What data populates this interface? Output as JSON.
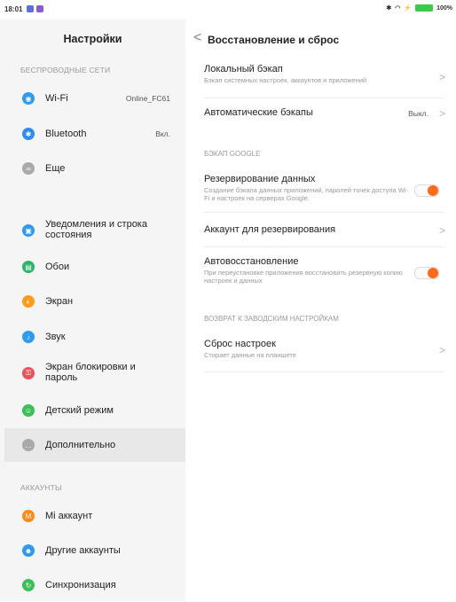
{
  "status": {
    "time": "18:01",
    "battery": "100%"
  },
  "left": {
    "title": "Настройки",
    "section_wireless": "БЕСПРОВОДНЫЕ СЕТИ",
    "wifi": {
      "label": "Wi-Fi",
      "value": "Online_FC61"
    },
    "bluetooth": {
      "label": "Bluetooth",
      "value": "Вкл."
    },
    "more": {
      "label": "Еще"
    },
    "notifications": {
      "label": "Уведомления и строка состояния"
    },
    "wallpaper": {
      "label": "Обои"
    },
    "display": {
      "label": "Экран"
    },
    "sound": {
      "label": "Звук"
    },
    "lockscreen": {
      "label": "Экран блокировки и пароль"
    },
    "kids": {
      "label": "Детский режим"
    },
    "additional": {
      "label": "Дополнительно"
    },
    "section_accounts": "АККАУНТЫ",
    "mi_account": {
      "label": "Mi аккаунт"
    },
    "other_accounts": {
      "label": "Другие аккаунты"
    },
    "sync": {
      "label": "Синхронизация"
    }
  },
  "right": {
    "title": "Восстановление и сброс",
    "local_backup": {
      "title": "Локальный бэкап",
      "subtitle": "Бэкап системных настроек, аккаунтов и приложений"
    },
    "auto_backup": {
      "title": "Автоматические бэкапы",
      "value": "Выкл."
    },
    "section_google": "БЭКАП GOOGLE",
    "data_backup": {
      "title": "Резервирование данных",
      "subtitle": "Создание бэкапа данных приложений, паролей точек доступа Wi-Fi и настроек на серверах Google.",
      "enabled": true
    },
    "backup_account": {
      "title": "Аккаунт для резервирования"
    },
    "auto_restore": {
      "title": "Автовосстановление",
      "subtitle": "При переустановке приложения восстановить резервную копию настроек и данных",
      "enabled": true
    },
    "section_factory": "ВОЗВРАТ К ЗАВОДСКИМ НАСТРОЙКАМ",
    "factory_reset": {
      "title": "Сброс настроек",
      "subtitle": "Стирает данные на планшете"
    }
  },
  "colors": {
    "wifi": "#2f9bf0",
    "bluetooth": "#2f8df0",
    "more": "#a9a9a9",
    "notifications": "#2f9bf0",
    "wallpaper": "#2db36a",
    "display": "#ff9c1a",
    "sound": "#2f9bf0",
    "lockscreen": "#f0505a",
    "kids": "#3cbf5a",
    "additional": "#a9a9a9",
    "mi": "#ff8a1a",
    "accounts": "#2f9bf0",
    "sync": "#3cbf5a",
    "toggle_on": "#ff6a1a"
  }
}
